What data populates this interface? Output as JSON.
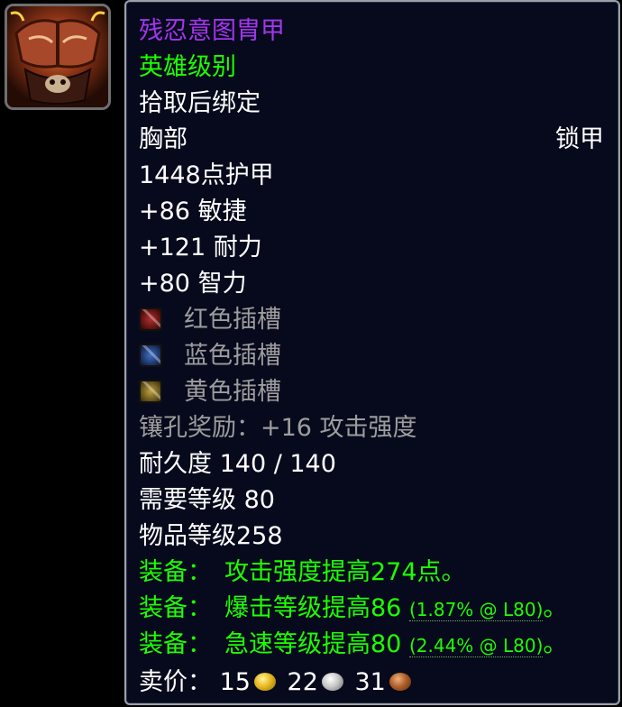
{
  "item": {
    "name": "残忍意图胄甲",
    "quality": "英雄级别",
    "binding": "拾取后绑定",
    "slot": "胸部",
    "armor_type": "锁甲",
    "armor": "1448点护甲",
    "stats": [
      {
        "value": "+86",
        "stat": "敏捷"
      },
      {
        "value": "+121",
        "stat": "耐力"
      },
      {
        "value": "+80",
        "stat": "智力"
      }
    ],
    "sockets": [
      {
        "label": "红色插槽",
        "color": "#b03030",
        "icon": "red-socket-icon"
      },
      {
        "label": "蓝色插槽",
        "color": "#4070c0",
        "icon": "blue-socket-icon"
      },
      {
        "label": "黄色插槽",
        "color": "#c0a040",
        "icon": "yellow-socket-icon"
      }
    ],
    "socket_bonus": "镶孔奖励：+16 攻击强度",
    "durability": "耐久度 140 / 140",
    "required_level": "需要等级 80",
    "item_level": "物品等级258",
    "equip_effects": [
      {
        "prefix": "装备：",
        "text": "攻击强度提高274点。",
        "detail": "",
        "suffix": ""
      },
      {
        "prefix": "装备：",
        "text": "爆击等级提高86",
        "detail": "(1.87% @ L80)",
        "suffix": "。"
      },
      {
        "prefix": "装备：",
        "text": "急速等级提高80",
        "detail": "(2.44% @ L80)",
        "suffix": "。"
      }
    ],
    "sell_price": {
      "label": "卖价：",
      "gold": "15",
      "silver": "22",
      "copper": "31"
    }
  },
  "colors": {
    "epic": "#a335ee",
    "heroic": "#1eff00",
    "equip": "#1eff00",
    "grey": "#9d9d9d",
    "tooltip_bg": "#060a1c",
    "border": "#9aa0ac"
  }
}
